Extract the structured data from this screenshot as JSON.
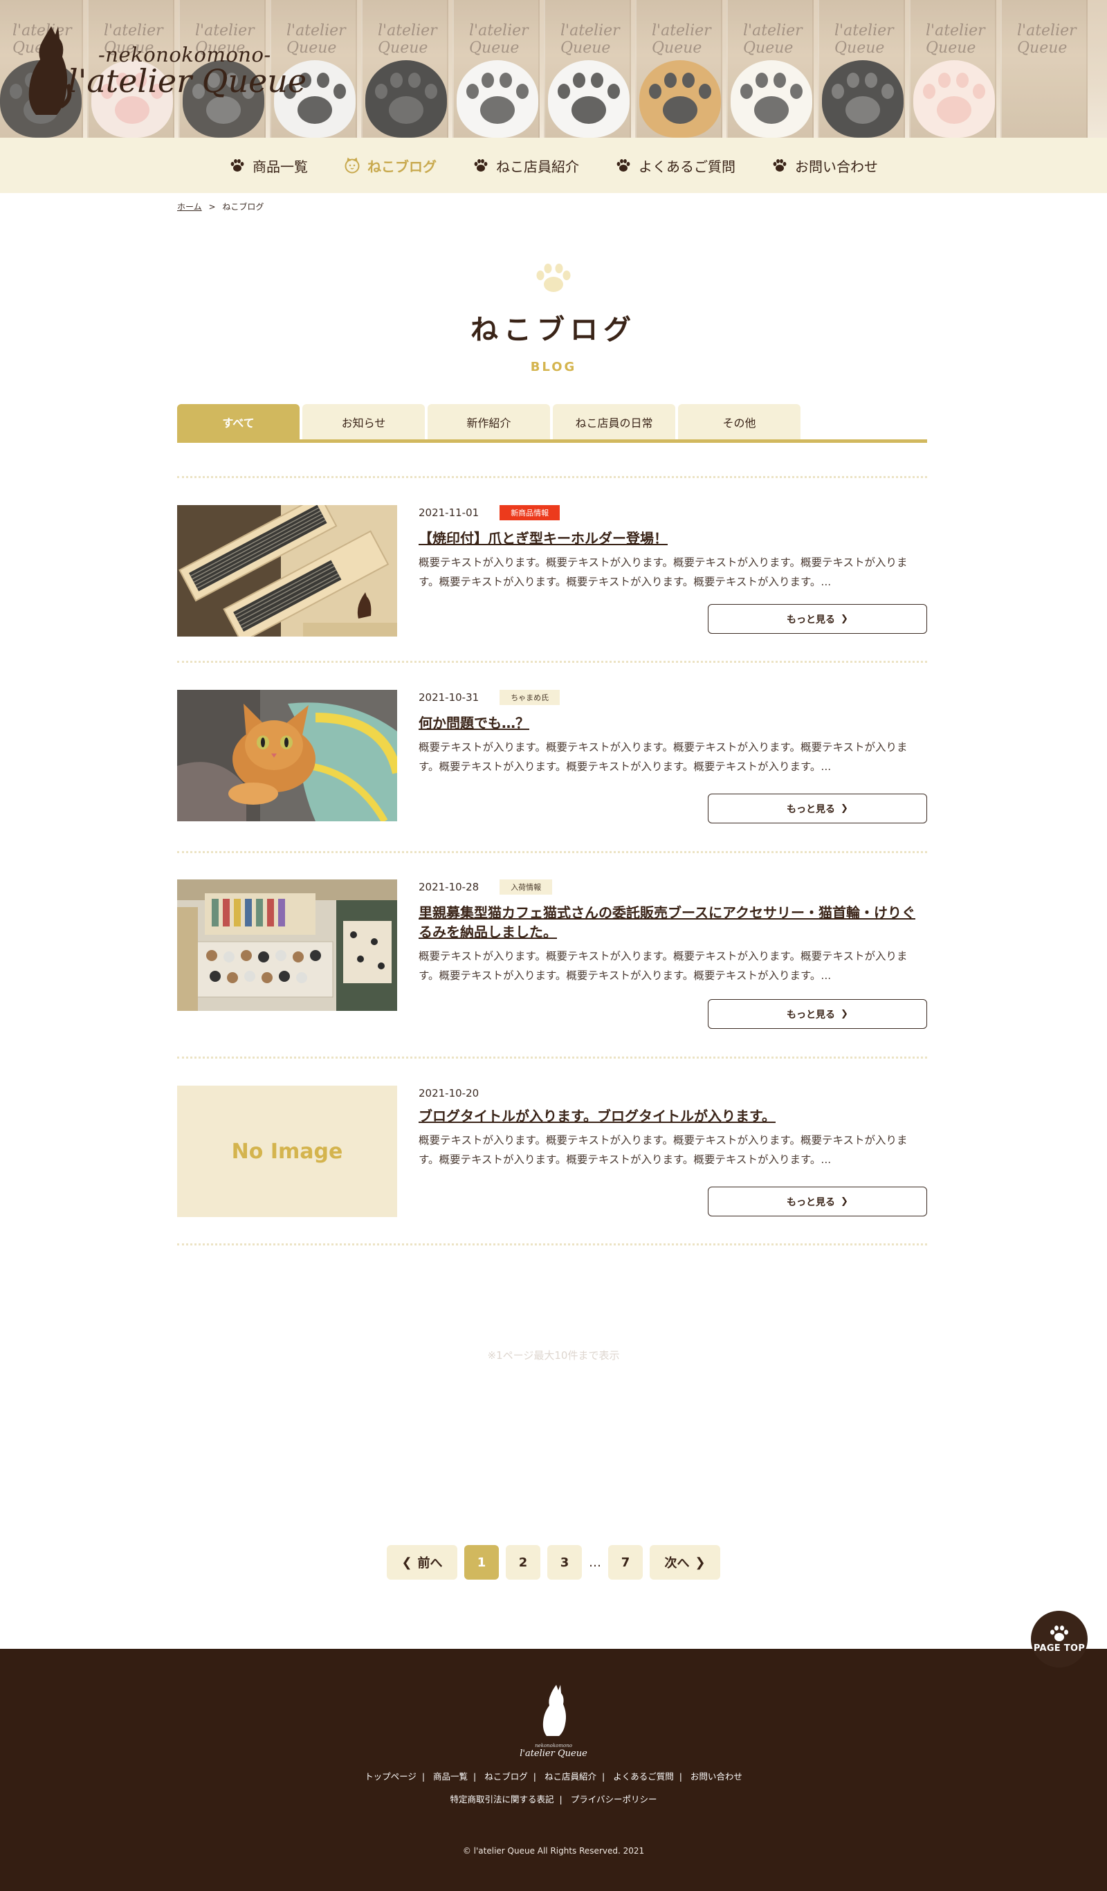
{
  "brand": {
    "subtitle": "-nekonokomono-",
    "name": "l'atelier Queue",
    "bag_tag": "l'atelier Queue"
  },
  "nav": {
    "items": [
      {
        "label": "商品一覧",
        "icon": "paw-icon"
      },
      {
        "label": "ねこブログ",
        "icon": "cat-face-icon"
      },
      {
        "label": "ねこ店員紹介",
        "icon": "paw-icon"
      },
      {
        "label": "よくあるご質問",
        "icon": "paw-icon"
      },
      {
        "label": "お問い合わせ",
        "icon": "paw-icon"
      }
    ],
    "active_index": 1
  },
  "breadcrumb": {
    "home": "ホーム",
    "separator": ">",
    "current": "ねこブログ"
  },
  "page": {
    "title": "ねこブログ",
    "subtitle": "BLOG"
  },
  "tabs": [
    "すべて",
    "お知らせ",
    "新作紹介",
    "ねこ店員の日常",
    "その他"
  ],
  "posts": [
    {
      "date": "2021-11-01",
      "category": "新商品情報",
      "title": "【焼印付】爪とぎ型キーホルダー登場！",
      "excerpt": "概要テキストが入ります。概要テキストが入ります。概要テキストが入ります。概要テキストが入ります。概要テキストが入ります。概要テキストが入ります。概要テキストが入ります。...",
      "more": "もっと見る"
    },
    {
      "date": "2021-10-31",
      "category": "ちゃまめ氏",
      "title": "何か問題でも…？",
      "excerpt": "概要テキストが入ります。概要テキストが入ります。概要テキストが入ります。概要テキストが入ります。概要テキストが入ります。概要テキストが入ります。概要テキストが入ります。...",
      "more": "もっと見る"
    },
    {
      "date": "2021-10-28",
      "category": "入荷情報",
      "title": "里親募集型猫カフェ猫式さんの委託販売ブースにアクセサリー・猫首輪・けりぐるみを納品しました。",
      "excerpt": "概要テキストが入ります。概要テキストが入ります。概要テキストが入ります。概要テキストが入ります。概要テキストが入ります。概要テキストが入ります。概要テキストが入ります。...",
      "more": "もっと見る"
    },
    {
      "date": "2021-10-20",
      "category": "",
      "title": "ブログタイトルが入ります。ブログタイトルが入ります。",
      "excerpt": "概要テキストが入ります。概要テキストが入ります。概要テキストが入ります。概要テキストが入ります。概要テキストが入ります。概要テキストが入ります。概要テキストが入ります。...",
      "more": "もっと見る",
      "no_image": "No Image"
    }
  ],
  "note": "※1ページ最大10件まで表示",
  "pagination": {
    "prev": "前へ",
    "next": "次へ",
    "pages": [
      "1",
      "2",
      "3",
      "7"
    ],
    "ellipsis": "…",
    "current": "1"
  },
  "page_top": "PAGE TOP",
  "footer": {
    "logo_sub": "nekonokomono",
    "logo_main": "l'atelier Queue",
    "links_row1": [
      "トップページ",
      "商品一覧",
      "ねこブログ",
      "ねこ店員紹介",
      "よくあるご質問",
      "お問い合わせ"
    ],
    "links_row2": [
      "特定商取引法に関する表記",
      "プライバシーポリシー"
    ],
    "separator": "|",
    "copyright": "© l'atelier Queue All Rights Reserved. 2021"
  },
  "colors": {
    "brown": "#3a2418",
    "gold": "#d1b85e",
    "cream": "#f6f0d8",
    "category_red": "#ec3a1c",
    "footer_bg": "#341e12"
  }
}
